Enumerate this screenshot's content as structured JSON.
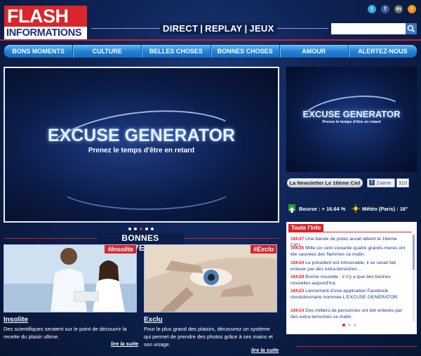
{
  "logo": {
    "line1": "FLASH",
    "line2": "INFORMATIONS"
  },
  "topnav": {
    "items": [
      "DIRECT",
      "REPLAY",
      "JEUX"
    ],
    "separator": "|"
  },
  "social": [
    {
      "icon": "twitter-icon",
      "glyph": "t",
      "color": "#2aa9e0"
    },
    {
      "icon": "facebook-icon",
      "glyph": "f",
      "color": "#3b5998"
    },
    {
      "icon": "myspace-icon",
      "glyph": "m",
      "color": "#6b6b6b"
    },
    {
      "icon": "rss-icon",
      "glyph": "r",
      "color": "#f2911b"
    }
  ],
  "search": {
    "placeholder": "",
    "value": ""
  },
  "menu": [
    "BONS MOMENTS",
    "CULTURE",
    "BELLES CHOSES",
    "BONNES CHOSES",
    "AMOUR",
    "ALERTEZ-NOUS"
  ],
  "hero": {
    "title": "EXCUSE GENERATOR",
    "subtitle": "Prenez le temps d'être en retard",
    "slides": 5,
    "active_slide": 3
  },
  "section": {
    "title": "BONNES NOUVELLES"
  },
  "cards": [
    {
      "tag": "#Insolite",
      "title": "Insolite",
      "text": "Des scientifiques seraient sur le point de découvrir la recette du plaisir ultime.",
      "more": "lire la suite"
    },
    {
      "tag": "#Exclu",
      "title": "Exclu",
      "text": "Pour le plus grand des plaisirs, découvrez un système qui permet de prendre des photos grâce à ses mains et son visage.",
      "more": "lire la suite"
    }
  ],
  "side": {
    "thumb_title": "EXCUSE GENERATOR",
    "thumb_subtitle": "Prenez le temps d'être en retard",
    "newsletter": "La Newsletter Le 16ème Ciel",
    "like_label": "J'aime",
    "like_count": "310",
    "bourse": "Bourse : + 16.64 %",
    "meteo": "Météo (Paris) : 16°"
  },
  "ticker": {
    "title": "Toute l'info",
    "items": [
      {
        "time": "16h37",
        "text": "Une bande de potes aurait atteint le 16ème CIEL."
      },
      {
        "time": "16h35",
        "text": "Mille six cent soixante quatre grands-meres ont été sauvées des flammes ce matin."
      },
      {
        "time": "16h34",
        "text": "Le président est introuvable, il se serait fait enlever par des extra-terrestres…"
      },
      {
        "time": "16h29",
        "text": "Bonne nouvelle : il n'y a que des bonnes nouvelles aujourd'hui."
      },
      {
        "time": "16h23",
        "text": "Lancement d'une application Facebook révolutionnaire nommée L'EXCUSE GENERATOR."
      },
      {
        "time": "16h14",
        "text": "Des milliers de personnes ont été enlevés par des extra-terrestres ce matin."
      }
    ],
    "pages": 3,
    "active_page": 1
  }
}
